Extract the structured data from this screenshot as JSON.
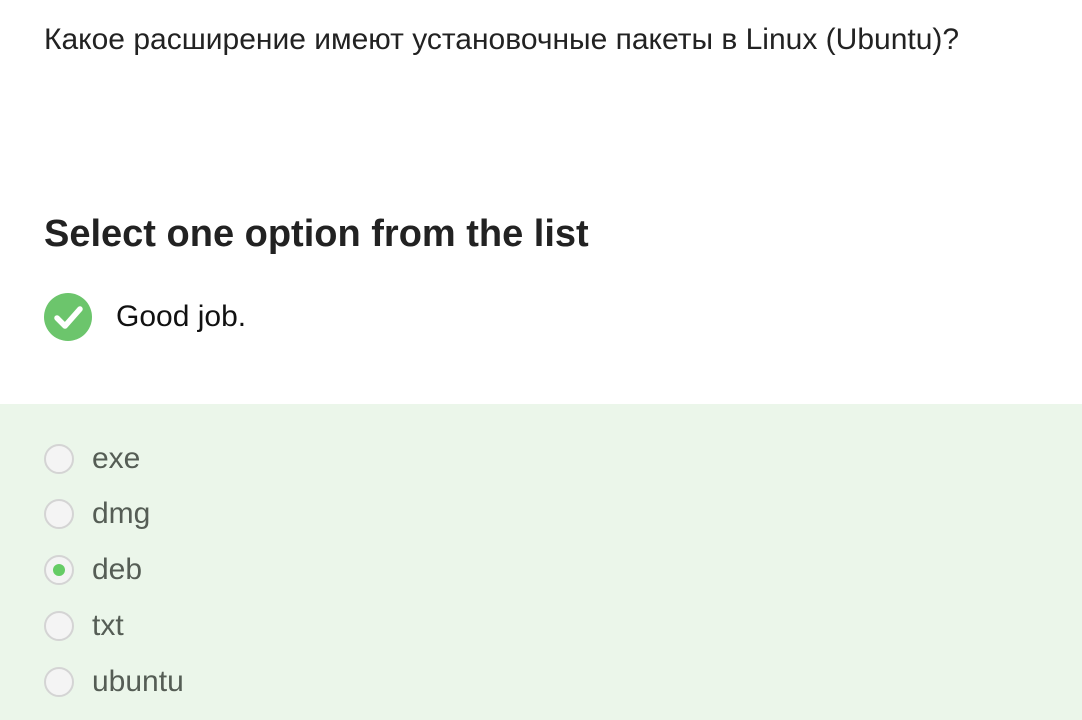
{
  "question": {
    "text": "Какое расширение имеют установочные пакеты в Linux (Ubuntu)?"
  },
  "instruction": "Select one option from the list",
  "feedback": {
    "icon": "check-circle-icon",
    "text": "Good job.",
    "color": "#6cc56c"
  },
  "options": [
    {
      "label": "exe",
      "selected": false
    },
    {
      "label": "dmg",
      "selected": false
    },
    {
      "label": "deb",
      "selected": true
    },
    {
      "label": "txt",
      "selected": false
    },
    {
      "label": "ubuntu",
      "selected": false
    }
  ],
  "colors": {
    "panel_background": "#ebf6ea",
    "accent": "#66cc66"
  }
}
